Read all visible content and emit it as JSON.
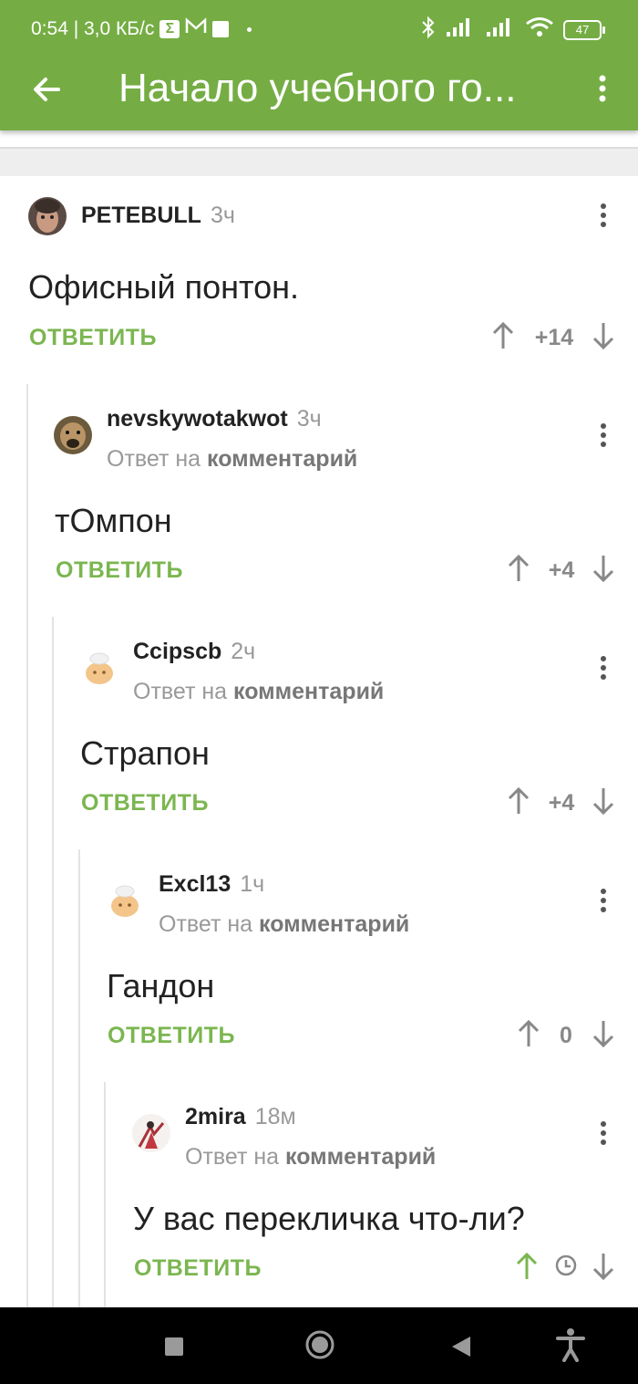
{
  "status": {
    "time": "0:54 | 3,0 КБ/с",
    "box_glyph": "Σ",
    "mail_glyph": "M",
    "battery": "47"
  },
  "appbar": {
    "title": "Начало учебного го..."
  },
  "comments": [
    {
      "author": "PETEBULL",
      "time": "3ч",
      "reply_prefix": "",
      "reply_target": "",
      "text": "Офисный понтон.",
      "answer": "ОТВЕТИТЬ",
      "score": "+14"
    },
    {
      "author": "nevskywotakwot",
      "time": "3ч",
      "reply_prefix": "Ответ на",
      "reply_target": "комментарий",
      "text": "тОмпон",
      "answer": "ОТВЕТИТЬ",
      "score": "+4"
    },
    {
      "author": "Ccipscb",
      "time": "2ч",
      "reply_prefix": "Ответ на",
      "reply_target": "комментарий",
      "text": "Страпон",
      "answer": "ОТВЕТИТЬ",
      "score": "+4"
    },
    {
      "author": "Excl13",
      "time": "1ч",
      "reply_prefix": "Ответ на",
      "reply_target": "комментарий",
      "text": "Гандон",
      "answer": "ОТВЕТИТЬ",
      "score": "0"
    },
    {
      "author": "2mira",
      "time": "18м",
      "reply_prefix": "Ответ на",
      "reply_target": "комментарий",
      "text": "У вас перекличка что-ли?",
      "answer": "ОТВЕТИТЬ",
      "score_icon": "clock-icon"
    }
  ],
  "colors": {
    "accent": "#75ad44",
    "answer": "#7bb650",
    "upvoted": "#7bb650"
  },
  "navbar": {
    "icons": [
      "square-icon",
      "home-circle-icon",
      "back-triangle-icon",
      "accessibility-icon"
    ]
  }
}
